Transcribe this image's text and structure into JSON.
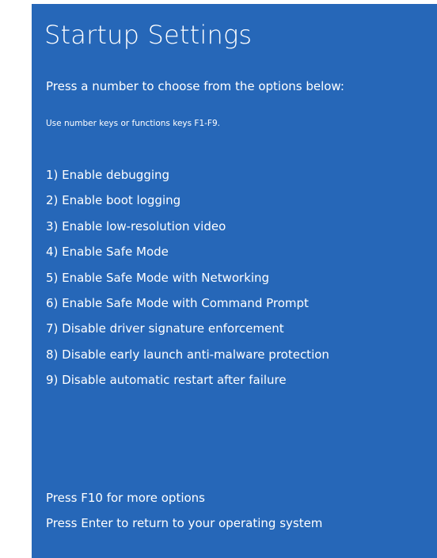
{
  "screen": {
    "background_color": "#2667b8",
    "text_color": "#ffffff",
    "title": "Startup Settings",
    "prompt": "Press a number to choose from the options below:",
    "hint": "Use number keys or functions keys F1-F9."
  },
  "options": [
    {
      "label": "1) Enable debugging"
    },
    {
      "label": "2) Enable boot logging"
    },
    {
      "label": "3) Enable low-resolution video"
    },
    {
      "label": "4) Enable Safe Mode"
    },
    {
      "label": "5) Enable Safe Mode with Networking"
    },
    {
      "label": "6) Enable Safe Mode with Command Prompt"
    },
    {
      "label": "7) Disable driver signature enforcement"
    },
    {
      "label": "8) Disable early launch anti-malware protection"
    },
    {
      "label": "9) Disable automatic restart after failure"
    }
  ],
  "footer": {
    "more_options": "Press F10 for more options",
    "return_to_os": "Press Enter to return to your operating system"
  }
}
